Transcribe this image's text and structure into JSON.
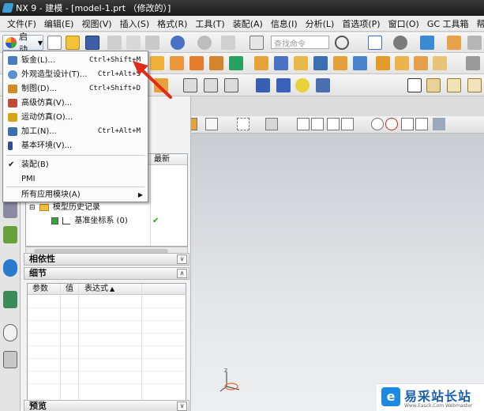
{
  "window": {
    "title": "NX 9 - 建模 - [model-1.prt （修改的）]"
  },
  "menubar": {
    "items": [
      "文件(F)",
      "编辑(E)",
      "视图(V)",
      "插入(S)",
      "格式(R)",
      "工具(T)",
      "装配(A)",
      "信息(I)",
      "分析(L)",
      "首选项(P)",
      "窗口(O)",
      "GC 工具箱",
      "帮助(H)"
    ]
  },
  "toolbar": {
    "start_label": "启动",
    "search_placeholder": "查找命令"
  },
  "start_menu": {
    "items": [
      {
        "label": "钣金(L)...",
        "shortcut": "Ctrl+Shift+M",
        "icon": "sheet-metal-icon",
        "color": "#4a7cc0"
      },
      {
        "label": "外观造型设计(T)...",
        "shortcut": "Ctrl+Alt+S",
        "icon": "shape-studio-icon",
        "color": "#5a8fd0"
      },
      {
        "label": "制图(D)...",
        "shortcut": "Ctrl+Shift+D",
        "icon": "drafting-icon",
        "color": "#d08a2a"
      },
      {
        "label": "高级仿真(V)...",
        "shortcut": "",
        "icon": "advanced-simulation-icon",
        "color": "#c24a3a"
      },
      {
        "label": "运动仿真(O)...",
        "shortcut": "",
        "icon": "motion-simulation-icon",
        "color": "#d6a419"
      },
      {
        "label": "加工(N)...",
        "shortcut": "Ctrl+Alt+M",
        "icon": "manufacturing-icon",
        "color": "#3a6fb0"
      },
      {
        "label": "基本环境(V)...",
        "shortcut": "",
        "icon": "gateway-icon",
        "color": "#2f4f8f"
      }
    ],
    "assembly_label": "装配(B)",
    "pmi_label": "PMI",
    "all_apps_label": "所有应用模块(A)"
  },
  "navigator": {
    "latest_col": "最新",
    "history_label": "模型历史记录",
    "datum_label": "基准坐标系 (0)",
    "dependencies_label": "相依性",
    "details_label": "细节",
    "preview_label": "预览",
    "details_columns": [
      "参数",
      "值",
      "表达式"
    ]
  },
  "watermark": {
    "logo_char": "e",
    "name": "易采站长站",
    "url": "Www.Easck.Com Webmaster"
  },
  "colors": {
    "titlebar": "#1f1f1f",
    "accent": "#3b7bd6",
    "arrow": "#e02a1a",
    "check": "#1aa81a"
  }
}
